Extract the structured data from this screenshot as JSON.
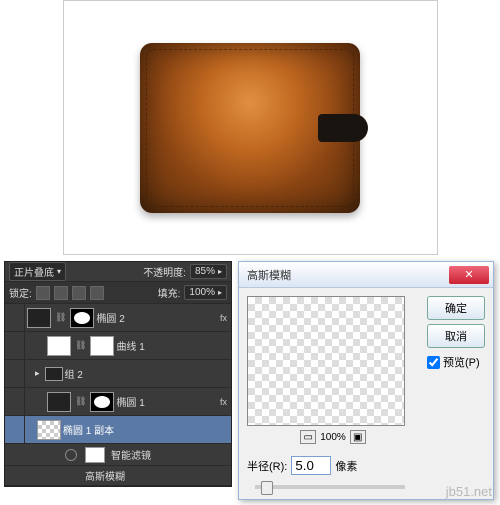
{
  "canvas": {
    "subject": "brown leather wallet"
  },
  "layers_panel": {
    "blend_mode": "正片叠底",
    "opacity_label": "不透明度:",
    "opacity_value": "85%",
    "lock_label": "锁定:",
    "fill_label": "填充:",
    "fill_value": "100%",
    "layers": [
      {
        "name": "椭圆 2",
        "fx": "fx",
        "indent": 0,
        "thumb1": "dark",
        "thumb2": "mask"
      },
      {
        "name": "曲线 1",
        "fx": null,
        "indent": 20,
        "thumb1": "white",
        "thumb2": "white"
      },
      {
        "name": "组 2",
        "fx": null,
        "indent": 10,
        "thumb1": "dark",
        "thumb2": null
      },
      {
        "name": "椭圆 1",
        "fx": "fx",
        "indent": 20,
        "thumb1": "dark",
        "thumb2": "mask"
      },
      {
        "name": "椭圆 1 副本",
        "fx": null,
        "indent": 10,
        "thumb1": "check",
        "thumb2": null,
        "selected": true
      },
      {
        "name": "智能滤镜",
        "fx": null,
        "indent": 40,
        "thumb1": "white",
        "thumb2": null,
        "smart": true
      }
    ],
    "filter_line": "高斯模糊"
  },
  "dialog": {
    "title": "高斯模糊",
    "ok": "确定",
    "cancel": "取消",
    "preview_checkbox": "预览(P)",
    "zoom": "100%",
    "radius_label": "半径(R):",
    "radius_value": "5.0",
    "radius_unit": "像素"
  },
  "watermark": "jb51.net"
}
